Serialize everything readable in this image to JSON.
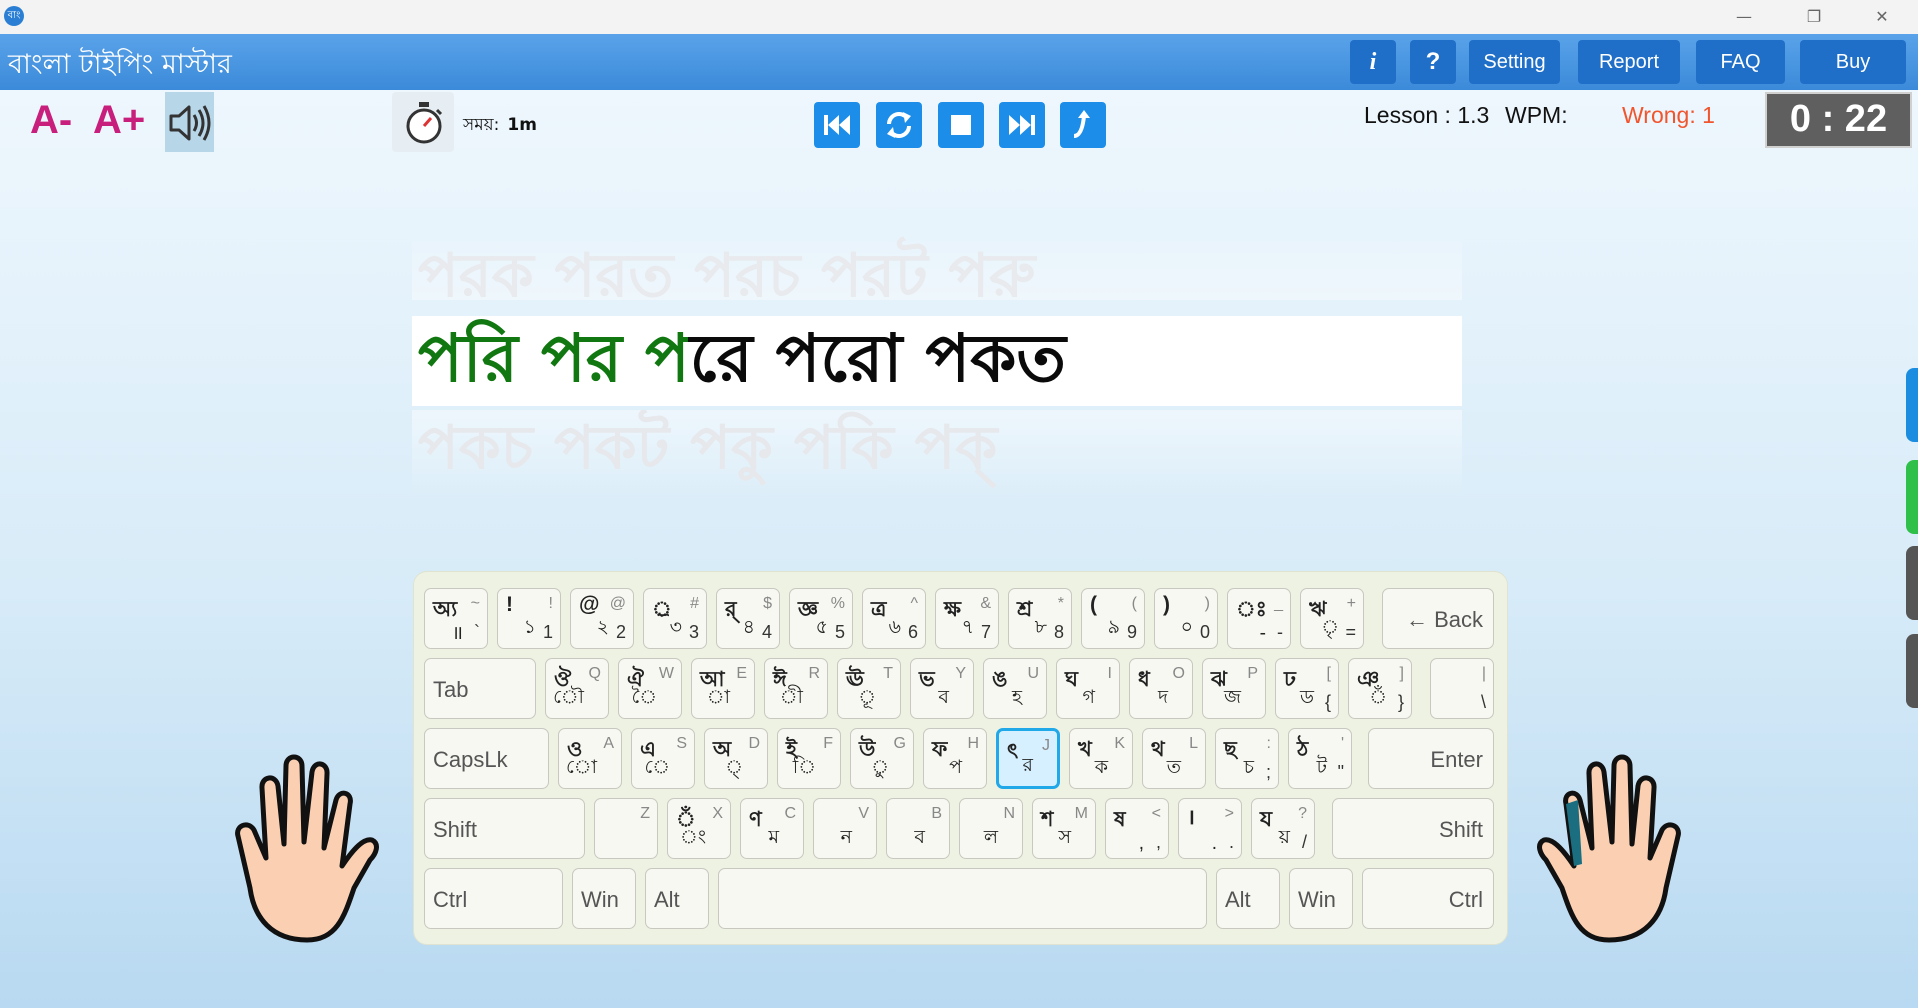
{
  "window": {
    "logo": "বাং",
    "minimize": "—",
    "restore": "❐",
    "close": "✕"
  },
  "header": {
    "title": "বাংলা টাইপিং মাস্টার",
    "buttons": {
      "info": "i",
      "help": "?",
      "setting": "Setting",
      "report": "Report",
      "faq": "FAQ",
      "buy": "Buy"
    }
  },
  "toolbar": {
    "font_decrease": "A-",
    "font_increase": "A+",
    "time_label": "সময়:",
    "time_value": "1m",
    "lesson": "Lesson : 1.3",
    "wpm": "WPM:",
    "wrong": "Wrong: 1",
    "clock": "0 : 22",
    "controls": [
      "first",
      "repeat",
      "stop",
      "last",
      "exit"
    ]
  },
  "practice": {
    "prev_line": "পরক পরত পরচ পরট পরু",
    "typed": "পরি পর প",
    "pending": "রে পরো পকত",
    "next_line": "পকচ পকট পকু পকি পক্"
  },
  "keyboard": {
    "row1": [
      {
        "bt": "অ্য",
        "et": "~",
        "bb": "॥",
        "eb": "`"
      },
      {
        "bt": "!",
        "et": "!",
        "bb": "১",
        "eb": "1"
      },
      {
        "bt": "@",
        "et": "@",
        "bb": "২",
        "eb": "2"
      },
      {
        "bt": "্র",
        "et": "#",
        "bb": "৩",
        "eb": "3"
      },
      {
        "bt": "র্",
        "et": "$",
        "bb": "৪",
        "eb": "4"
      },
      {
        "bt": "জ্ঞ",
        "et": "%",
        "bb": "৫",
        "eb": "5"
      },
      {
        "bt": "ত্র",
        "et": "^",
        "bb": "৬",
        "eb": "6"
      },
      {
        "bt": "ক্ষ",
        "et": "&",
        "bb": "৭",
        "eb": "7"
      },
      {
        "bt": "শ্র",
        "et": "*",
        "bb": "৮",
        "eb": "8"
      },
      {
        "bt": "(",
        "et": "(",
        "bb": "৯",
        "eb": "9"
      },
      {
        "bt": ")",
        "et": ")",
        "bb": "০",
        "eb": "0"
      },
      {
        "bt": "ঃ",
        "et": "_",
        "bb": "-",
        "eb": "-"
      },
      {
        "bt": "ঋ",
        "et": "+",
        "bb": "ৃ",
        "eb": "="
      }
    ],
    "backspace": "← Back",
    "tab": "Tab",
    "row2": [
      {
        "bt": "ঔ",
        "et": "Q",
        "bb": "ৌ",
        "eb": ""
      },
      {
        "bt": "ঐ",
        "et": "W",
        "bb": "ৈ",
        "eb": ""
      },
      {
        "bt": "আ",
        "et": "E",
        "bb": "া",
        "eb": ""
      },
      {
        "bt": "ঈ",
        "et": "R",
        "bb": "ী",
        "eb": ""
      },
      {
        "bt": "ঊ",
        "et": "T",
        "bb": "ূ",
        "eb": ""
      },
      {
        "bt": "ভ",
        "et": "Y",
        "bb": "ব",
        "eb": ""
      },
      {
        "bt": "ঙ",
        "et": "U",
        "bb": "হ",
        "eb": ""
      },
      {
        "bt": "ঘ",
        "et": "I",
        "bb": "গ",
        "eb": ""
      },
      {
        "bt": "ধ",
        "et": "O",
        "bb": "দ",
        "eb": ""
      },
      {
        "bt": "ঝ",
        "et": "P",
        "bb": "জ",
        "eb": ""
      },
      {
        "bt": "ঢ",
        "et": "[",
        "bb": "ড",
        "eb": "{"
      },
      {
        "bt": "ঞ",
        "et": "]",
        "bb": "ঁ",
        "eb": "}"
      },
      {
        "bt": "",
        "et": "|",
        "bb": "",
        "eb": "\\"
      }
    ],
    "capslock": "CapsLk",
    "row3": [
      {
        "bt": "ও",
        "et": "A",
        "bb": "ো",
        "eb": ""
      },
      {
        "bt": "এ",
        "et": "S",
        "bb": "ে",
        "eb": ""
      },
      {
        "bt": "অ",
        "et": "D",
        "bb": "্",
        "eb": ""
      },
      {
        "bt": "ই",
        "et": "F",
        "bb": "ি",
        "eb": ""
      },
      {
        "bt": "উ",
        "et": "G",
        "bb": "ু",
        "eb": ""
      },
      {
        "bt": "ফ",
        "et": "H",
        "bb": "প",
        "eb": ""
      },
      {
        "bt": "ৎ",
        "et": "J",
        "bb": "র",
        "eb": ""
      },
      {
        "bt": "খ",
        "et": "K",
        "bb": "ক",
        "eb": ""
      },
      {
        "bt": "থ",
        "et": "L",
        "bb": "ত",
        "eb": ""
      },
      {
        "bt": "ছ",
        "et": ":",
        "bb": "চ",
        "eb": ";"
      },
      {
        "bt": "ঠ",
        "et": "'",
        "bb": "ট",
        "eb": "\""
      }
    ],
    "enter": "Enter",
    "shift_left": "Shift",
    "row4": [
      {
        "bt": "",
        "et": "Z",
        "bb": "",
        "eb": ""
      },
      {
        "bt": "ঁ",
        "et": "X",
        "bb": "ং",
        "eb": ""
      },
      {
        "bt": "ণ",
        "et": "C",
        "bb": "ম",
        "eb": ""
      },
      {
        "bt": "",
        "et": "V",
        "bb": "ন",
        "eb": ""
      },
      {
        "bt": "",
        "et": "B",
        "bb": "ব",
        "eb": ""
      },
      {
        "bt": "",
        "et": "N",
        "bb": "ল",
        "eb": ""
      },
      {
        "bt": "শ",
        "et": "M",
        "bb": "স",
        "eb": ""
      },
      {
        "bt": "ষ",
        "et": "<",
        "bb": ",",
        "eb": ","
      },
      {
        "bt": "।",
        "et": ">",
        "bb": ".",
        "eb": "."
      },
      {
        "bt": "য",
        "et": "?",
        "bb": "য়",
        "eb": "/"
      }
    ],
    "shift_right": "Shift",
    "bottom": {
      "ctrl_left": "Ctrl",
      "win_left": "Win",
      "alt_left": "Alt",
      "alt_right": "Alt",
      "win_right": "Win",
      "ctrl_right": "Ctrl"
    },
    "highlighted": "J"
  },
  "colors": {
    "header": "#3b8ad9",
    "button": "#1f6fc9",
    "typed": "#117711",
    "wrong": "#f0552e",
    "font_btn": "#c81f7d",
    "control": "#1c8de8",
    "highlight": "#20a8e8"
  },
  "side_tabs": [
    "#1a8de0",
    "#2fc04a",
    "#555555",
    "#555555"
  ]
}
